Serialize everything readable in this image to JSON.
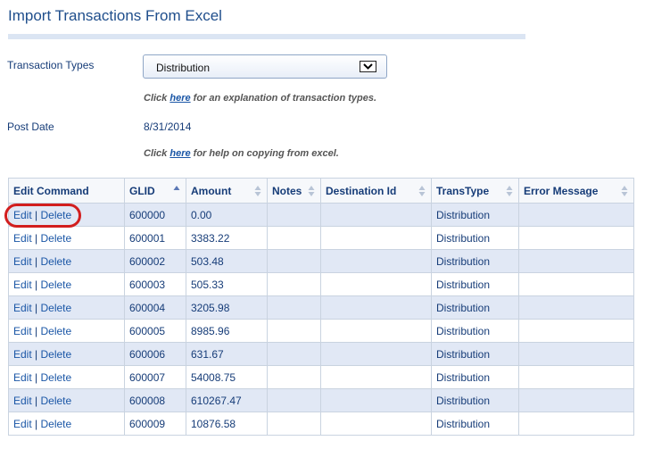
{
  "page": {
    "title": "Import Transactions From Excel"
  },
  "form": {
    "transaction_types_label": "Transaction Types",
    "transaction_type_selected": "Distribution",
    "hint1": {
      "prefix": "Click ",
      "link": "here",
      "suffix": " for an explanation of transaction types."
    },
    "post_date_label": "Post Date",
    "post_date_value": "8/31/2014",
    "hint2": {
      "prefix": "Click ",
      "link": "here",
      "suffix": " for help on copying from excel."
    }
  },
  "grid": {
    "columns": [
      {
        "key": "edit",
        "label": "Edit Command",
        "sort": "none"
      },
      {
        "key": "glid",
        "label": "GLID",
        "sort": "asc"
      },
      {
        "key": "amount",
        "label": "Amount",
        "sort": "both"
      },
      {
        "key": "notes",
        "label": "Notes",
        "sort": "both"
      },
      {
        "key": "destination",
        "label": "Destination Id",
        "sort": "both"
      },
      {
        "key": "transtype",
        "label": "TransType",
        "sort": "both"
      },
      {
        "key": "error",
        "label": "Error Message",
        "sort": "both"
      }
    ],
    "edit_label": "Edit",
    "separator": "|",
    "delete_label": "Delete",
    "rows": [
      {
        "glid": "600000",
        "amount": "0.00",
        "notes": "",
        "destination": "",
        "transtype": "Distribution",
        "error": ""
      },
      {
        "glid": "600001",
        "amount": "3383.22",
        "notes": "",
        "destination": "",
        "transtype": "Distribution",
        "error": ""
      },
      {
        "glid": "600002",
        "amount": "503.48",
        "notes": "",
        "destination": "",
        "transtype": "Distribution",
        "error": ""
      },
      {
        "glid": "600003",
        "amount": "505.33",
        "notes": "",
        "destination": "",
        "transtype": "Distribution",
        "error": ""
      },
      {
        "glid": "600004",
        "amount": "3205.98",
        "notes": "",
        "destination": "",
        "transtype": "Distribution",
        "error": ""
      },
      {
        "glid": "600005",
        "amount": "8985.96",
        "notes": "",
        "destination": "",
        "transtype": "Distribution",
        "error": ""
      },
      {
        "glid": "600006",
        "amount": "631.67",
        "notes": "",
        "destination": "",
        "transtype": "Distribution",
        "error": ""
      },
      {
        "glid": "600007",
        "amount": "54008.75",
        "notes": "",
        "destination": "",
        "transtype": "Distribution",
        "error": ""
      },
      {
        "glid": "600008",
        "amount": "610267.47",
        "notes": "",
        "destination": "",
        "transtype": "Distribution",
        "error": ""
      },
      {
        "glid": "600009",
        "amount": "10876.58",
        "notes": "",
        "destination": "",
        "transtype": "Distribution",
        "error": ""
      }
    ]
  },
  "annotation": {
    "highlight_color": "#d21e1e"
  },
  "colors": {
    "title": "#1f4e8c",
    "link": "#1a56a6",
    "row_alt": "#e1e8f5",
    "sort_active": "#5b78b5",
    "sort_inactive": "#b8c4d6"
  }
}
